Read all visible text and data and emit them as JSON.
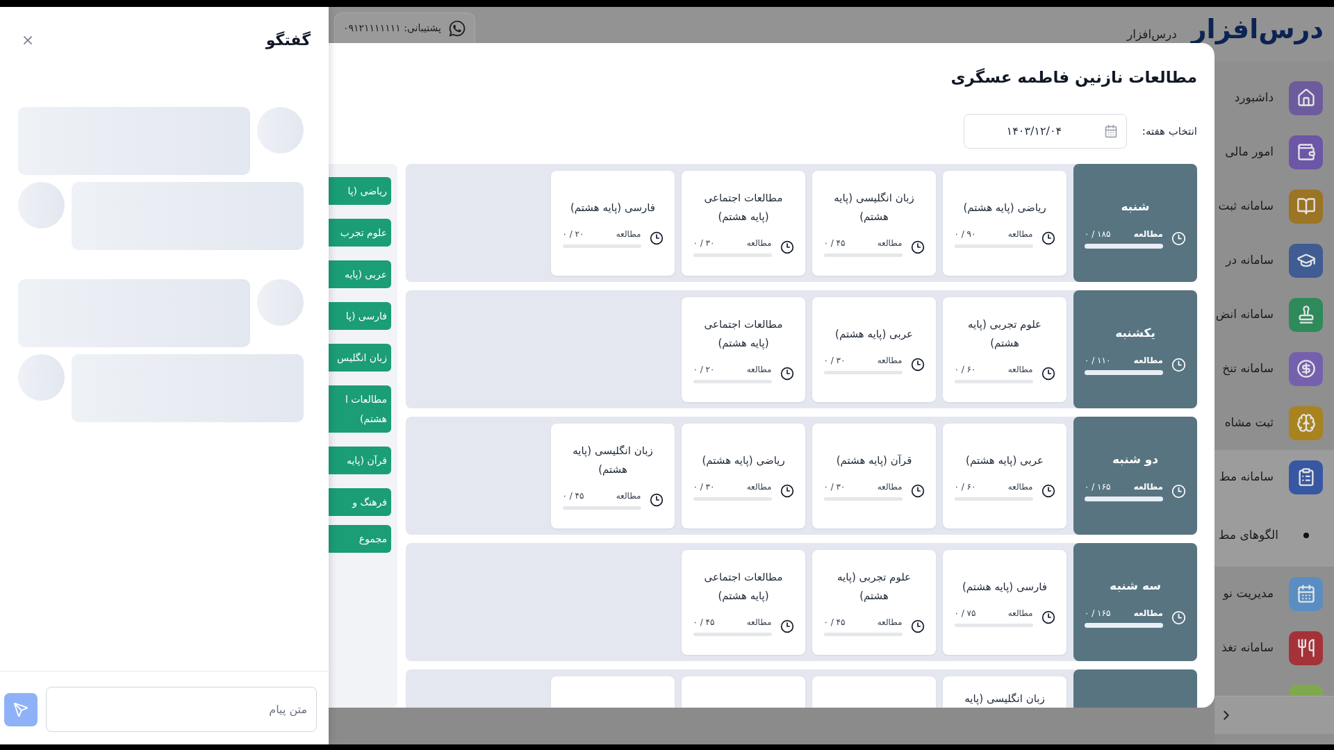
{
  "header": {
    "logo_text": "درس‌افزار",
    "brand_name": "درس‌افزار",
    "support_text": "پشتیبانی: ۰۹۱۲۱۱۱۱۱۱۱"
  },
  "sidebar": {
    "items": [
      {
        "label": "داشبورد",
        "color": "#6d5b9e"
      },
      {
        "label": "امور مالی",
        "color": "#6c56a6"
      },
      {
        "label": "سامانه ثبت",
        "color": "#9b7424"
      },
      {
        "label": "سامانه در",
        "color": "#3f5c93"
      },
      {
        "label": "سامانه انض",
        "color": "#2f8a5b"
      },
      {
        "label": "سامانه تنخ",
        "color": "#7560ae"
      },
      {
        "label": "ثبت مشاه",
        "color": "#a8831f"
      },
      {
        "label": "سامانه مط",
        "color": "#3757a2",
        "expanded": true,
        "children": [
          {
            "label": "الگوهای مط"
          }
        ]
      },
      {
        "label": "مدیریت نو",
        "color": "#5a8ec2"
      },
      {
        "label": "سامانه تغذ",
        "color": "#a53239"
      },
      {
        "color": "#7fa94c"
      }
    ]
  },
  "modal": {
    "title": "مطالعات نازنین فاطمه عسگری",
    "week_label": "انتخاب هفته:",
    "week_value": "۱۴۰۳/۱۲/۰۴",
    "days": [
      {
        "name": "شنبه",
        "label": "مطالعه",
        "value": "۰ / ۱۸۵",
        "cards": [
          {
            "title": "ریاضی (پایه هشتم)",
            "label": "مطالعه",
            "value": "۰ / ۹۰"
          },
          {
            "title": "زبان انگلیسی (پایه هشتم)",
            "label": "مطالعه",
            "value": "۰ / ۴۵"
          },
          {
            "title": "مطالعات اجتماعی (پایه هشتم)",
            "label": "مطالعه",
            "value": "۰ / ۳۰"
          },
          {
            "title": "فارسی (پایه هشتم)",
            "label": "مطالعه",
            "value": "۰ / ۲۰"
          }
        ]
      },
      {
        "name": "یکشنبه",
        "label": "مطالعه",
        "value": "۰ / ۱۱۰",
        "cards": [
          {
            "title": "علوم تجربی (پایه هشتم)",
            "label": "مطالعه",
            "value": "۰ / ۶۰"
          },
          {
            "title": "عربی (پایه هشتم)",
            "label": "مطالعه",
            "value": "۰ / ۳۰"
          },
          {
            "title": "مطالعات اجتماعی (پایه هشتم)",
            "label": "مطالعه",
            "value": "۰ / ۲۰"
          }
        ]
      },
      {
        "name": "دو شنبه",
        "label": "مطالعه",
        "value": "۰ / ۱۶۵",
        "cards": [
          {
            "title": "عربی (پایه هشتم)",
            "label": "مطالعه",
            "value": "۰ / ۶۰"
          },
          {
            "title": "قرآن (پایه هشتم)",
            "label": "مطالعه",
            "value": "۰ / ۳۰"
          },
          {
            "title": "ریاضی (پایه هشتم)",
            "label": "مطالعه",
            "value": "۰ / ۳۰"
          },
          {
            "title": "زبان انگلیسی (پایه هشتم)",
            "label": "مطالعه",
            "value": "۰ / ۴۵"
          }
        ]
      },
      {
        "name": "سه شنبه",
        "label": "مطالعه",
        "value": "۰ / ۱۶۵",
        "cards": [
          {
            "title": "فارسی (پایه هشتم)",
            "label": "مطالعه",
            "value": "۰ / ۷۵"
          },
          {
            "title": "علوم تجربی (پایه هشتم)",
            "label": "مطالعه",
            "value": "۰ / ۴۵"
          },
          {
            "title": "مطالعات اجتماعی (پایه هشتم)",
            "label": "مطالعه",
            "value": "۰ / ۴۵"
          }
        ]
      },
      {
        "cards": [
          {
            "kind": "titled",
            "title": "زبان انگلیسی (پایه"
          },
          {
            "kind": "blank"
          },
          {
            "kind": "blank"
          },
          {
            "kind": "blank"
          }
        ]
      }
    ],
    "legend": [
      {
        "label": "ریاضی (پا",
        "kind": "subject"
      },
      {
        "label": "علوم تجرب",
        "kind": "subject"
      },
      {
        "label": "عربی (پایه",
        "kind": "subject"
      },
      {
        "label": "فارسی (پا",
        "kind": "subject"
      },
      {
        "label": "زبان انگلیس",
        "kind": "subject"
      },
      {
        "label": "مطالعات ا\nهشتم)",
        "kind": "subject"
      },
      {
        "label": "قرآن (پایه",
        "kind": "subject"
      },
      {
        "label": "فرهنگ و",
        "kind": "subject"
      },
      {
        "label": "مجموع",
        "kind": "total"
      }
    ]
  },
  "chat": {
    "title": "گفتگو",
    "placeholders": [
      {
        "kind": "received"
      },
      {
        "kind": "sent"
      },
      {
        "kind": "received"
      },
      {
        "kind": "sent"
      }
    ],
    "message_placeholder": "متن پیام"
  }
}
